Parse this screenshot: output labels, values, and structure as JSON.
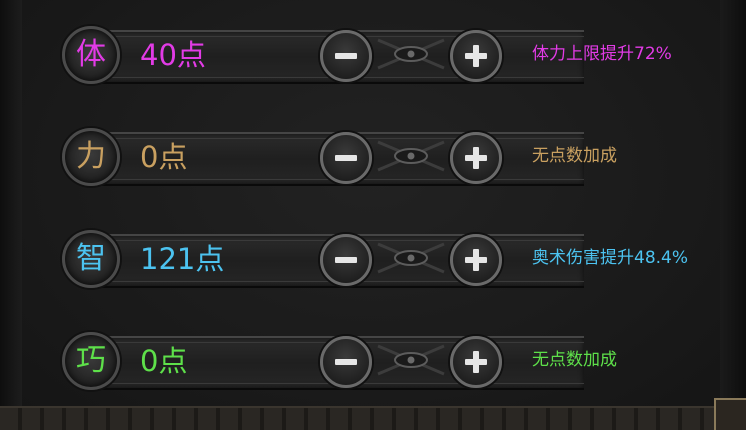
{
  "colors": {
    "stamina": "#e23be6",
    "strength": "#c9a060",
    "intellect": "#4cc3f0",
    "dexterity": "#5ee04a",
    "button_glyph": "#e6e6e6"
  },
  "stats": [
    {
      "key": "stamina",
      "label": "体",
      "points": "40点",
      "bonus": "体力上限提升72%"
    },
    {
      "key": "strength",
      "label": "力",
      "points": "0点",
      "bonus": "无点数加成"
    },
    {
      "key": "intellect",
      "label": "智",
      "points": "121点",
      "bonus": "奥术伤害提升48.4%"
    },
    {
      "key": "dexterity",
      "label": "巧",
      "points": "0点",
      "bonus": "无点数加成"
    }
  ],
  "icons": {
    "minus": "minus-icon",
    "plus": "plus-icon",
    "divider": "eye-ornament-icon"
  }
}
